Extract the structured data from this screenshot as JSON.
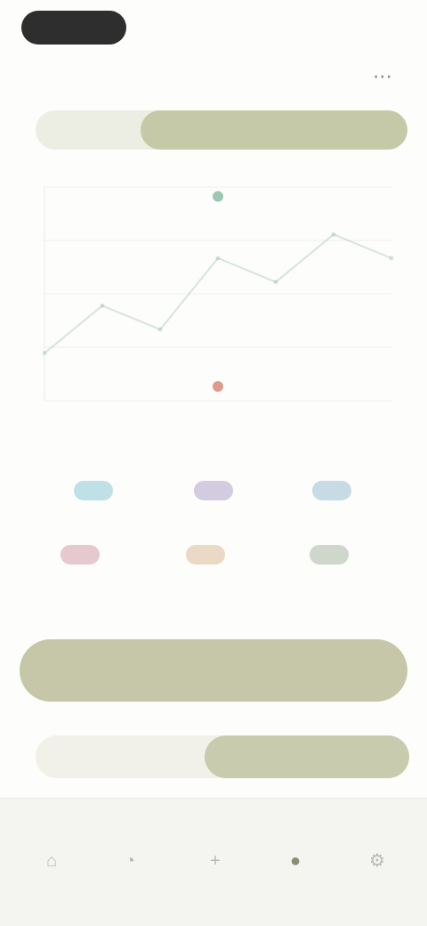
{
  "status_bar": {
    "pill_text": "",
    "right_text": ""
  },
  "header": {
    "title": "",
    "action_icon": "more-icon",
    "action_glyph": "⋯"
  },
  "segments": [
    {
      "label": "",
      "selected": false
    },
    {
      "label": "",
      "selected": true
    }
  ],
  "chart_data": {
    "type": "line",
    "x": [
      0,
      1,
      2,
      3,
      4,
      5,
      6
    ],
    "series": [
      {
        "values": [
          2,
          4,
          3,
          6,
          5,
          7,
          6
        ],
        "color": "#8fb7a4"
      }
    ],
    "markers": [
      {
        "x": 3,
        "y": 8.6,
        "color": "#9cc7b1"
      },
      {
        "x": 3,
        "y": 0.6,
        "color": "#e09a8a"
      }
    ],
    "ylim": [
      0,
      9
    ],
    "grid": true
  },
  "categories": {
    "heading": "",
    "items": [
      {
        "label": "",
        "color": "#bfe0e6"
      },
      {
        "label": "",
        "color": "#d3cbe0"
      },
      {
        "label": "",
        "color": "#c6dbe6"
      },
      {
        "label": "",
        "color": "#e6c8cf"
      },
      {
        "label": "",
        "color": "#ead9c4"
      },
      {
        "label": "",
        "color": "#cfd6cc"
      }
    ]
  },
  "primary_button": {
    "label": ""
  },
  "toggle": {
    "left_label": "",
    "right_label": ""
  },
  "bottom_nav": {
    "left_caption": "",
    "right_caption": "",
    "items": [
      {
        "label": "",
        "icon": "home-icon",
        "glyph": "⌂",
        "active": false
      },
      {
        "label": "",
        "icon": "stats-icon",
        "glyph": "◔",
        "active": false
      },
      {
        "label": "",
        "icon": "plus-icon",
        "glyph": "+",
        "active": false
      },
      {
        "label": "",
        "icon": "user-icon",
        "glyph": "●",
        "active": true
      },
      {
        "label": "",
        "icon": "settings-icon",
        "glyph": "⚙",
        "active": false
      }
    ]
  }
}
